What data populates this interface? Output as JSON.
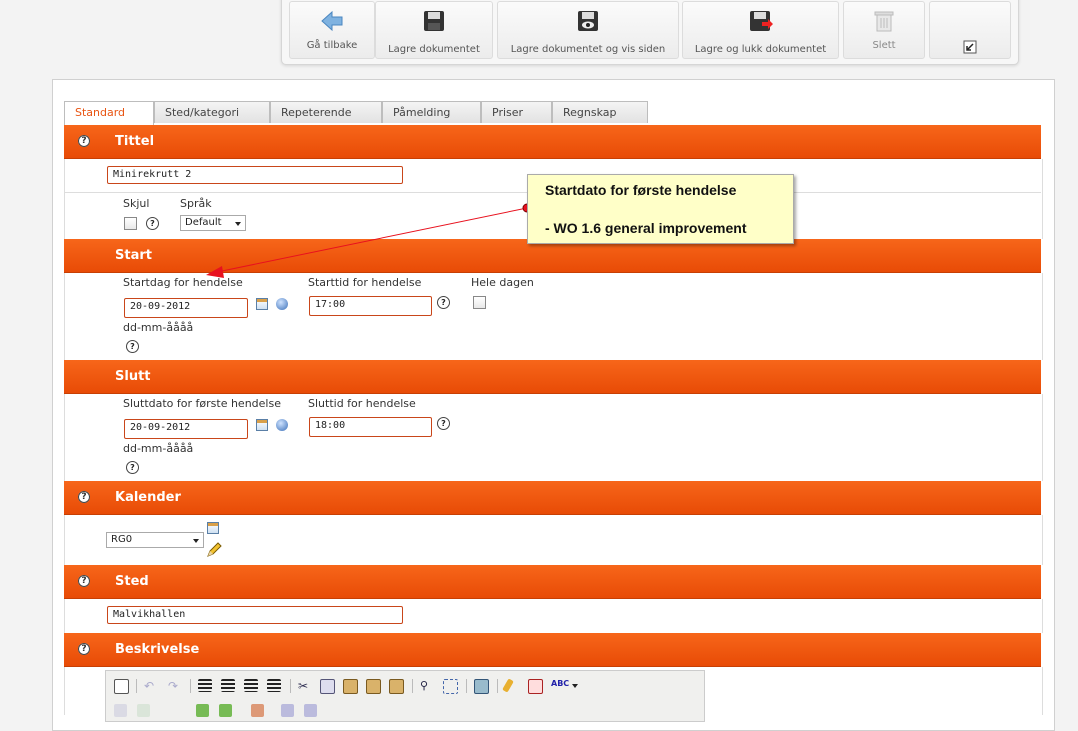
{
  "toolbar": {
    "back": "Gå tilbake",
    "save": "Lagre dokumentet",
    "save_view": "Lagre dokumentet og vis siden",
    "save_close": "Lagre og lukk dokumentet",
    "delete": "Slett"
  },
  "tabs": [
    "Standard",
    "Sted/kategori",
    "Repeterende",
    "Påmelding",
    "Priser",
    "Regnskap"
  ],
  "sections": {
    "tittel": "Tittel",
    "start": "Start",
    "slutt": "Slutt",
    "kalender": "Kalender",
    "sted": "Sted",
    "beskrivelse": "Beskrivelse"
  },
  "help_glyph": "?",
  "title_value": "Minirekrutt 2",
  "hide_label": "Skjul",
  "language_label": "Språk",
  "language_value": "Default",
  "start": {
    "date_label": "Startdag for hendelse",
    "date_value": "20-09-2012",
    "date_format": "dd-mm-åååå",
    "time_label": "Starttid for hendelse",
    "time_value": "17:00",
    "allday_label": "Hele dagen"
  },
  "end": {
    "date_label": "Sluttdato for første hendelse",
    "date_value": "20-09-2012",
    "date_format": "dd-mm-åååå",
    "time_label": "Sluttid for hendelse",
    "time_value": "18:00"
  },
  "calendar_value": "RG0",
  "place_value": "Malvikhallen",
  "callout": {
    "line1": "Startdato for første hendelse",
    "line2": "- WO 1.6 general improvement"
  },
  "colors": {
    "accent": "#ee5410",
    "callout_bg": "#ffffc8",
    "arrow": "#e8111e"
  }
}
